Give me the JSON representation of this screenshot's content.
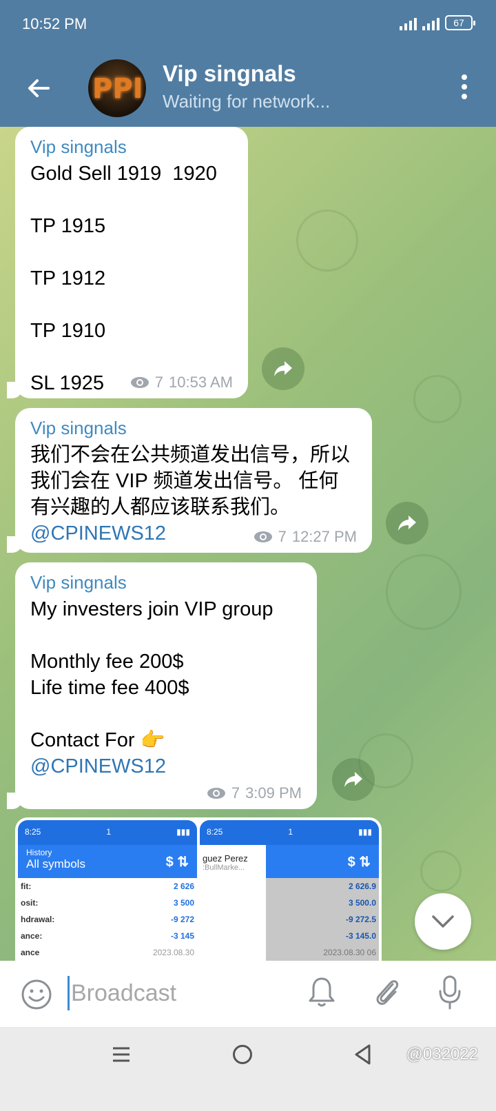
{
  "status_bar": {
    "time": "10:52 PM",
    "battery": "67"
  },
  "header": {
    "title": "Vip singnals",
    "subtitle": "Waiting for network...",
    "avatar_text": "PPI"
  },
  "messages": [
    {
      "sender": "Vip singnals",
      "text": "Gold Sell 1919  1920\n\nTP 1915\n\nTP 1912\n\nTP 1910\n\nSL 1925",
      "views": "7",
      "time": "10:53 AM"
    },
    {
      "sender": "Vip singnals",
      "text": "我们不会在公共频道发出信号，所以我们会在 VIP 频道发出信号。 任何有兴趣的人都应该联系我们。",
      "mention": "@CPINEWS12",
      "views": "7",
      "time": "12:27 PM"
    },
    {
      "sender": "Vip singnals",
      "text": "My investers join VIP group\n\nMonthly fee 200$\nLife time fee 400$\n\nContact For 👉\n",
      "mention": "@CPINEWS12",
      "views": "7",
      "time": "3:09 PM"
    }
  ],
  "media": {
    "left": {
      "time": "8:25",
      "pill": "1",
      "title_small": "History",
      "title": "All symbols",
      "rows": [
        {
          "label": "fit:",
          "value": "2 626"
        },
        {
          "label": "osit:",
          "value": "3 500"
        },
        {
          "label": "hdrawal:",
          "value": "-9 272"
        },
        {
          "label": "ance:",
          "value": "-3 145"
        },
        {
          "label": "ance",
          "value": "2023.08.30"
        }
      ]
    },
    "right": {
      "time": "8:25",
      "pill": "1",
      "popup_name": "guez Perez",
      "popup_sub": ":BullMarke...",
      "rows": [
        {
          "label": "",
          "value": "2 626.9"
        },
        {
          "label": "",
          "value": "3 500.0"
        },
        {
          "label": "",
          "value": "-9 272.5"
        },
        {
          "label": "",
          "value": "-3 145.0"
        },
        {
          "label": "",
          "value": "2023.08.30 06"
        }
      ]
    }
  },
  "composer": {
    "placeholder": "Broadcast"
  },
  "watermark": "@032022",
  "colors": {
    "header": "#517da2",
    "accent": "#3f8ac0",
    "link": "#2f76b5"
  }
}
